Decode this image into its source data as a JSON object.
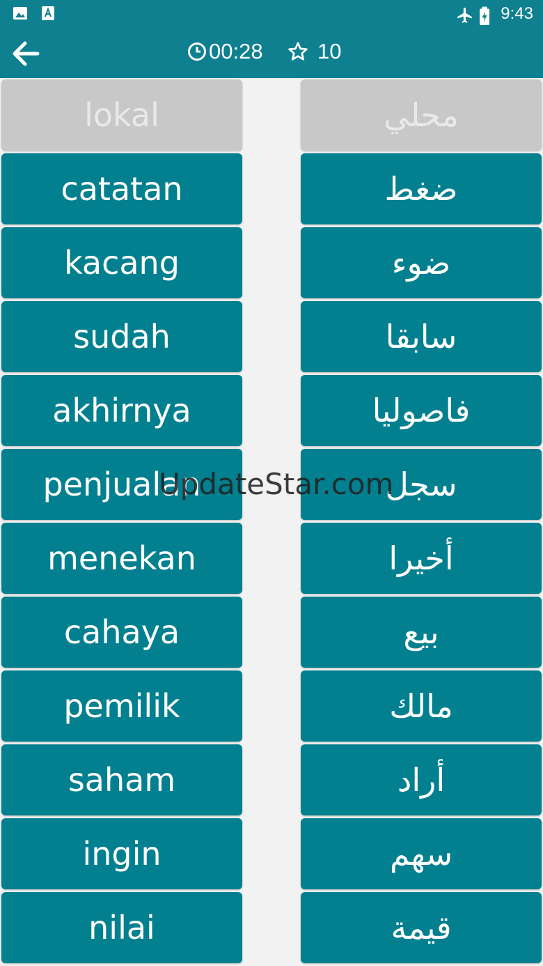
{
  "status_bar": {
    "time": "9:43",
    "icons_left": [
      "image-icon",
      "text-a-icon"
    ],
    "icons_right": [
      "airplane-icon",
      "battery-charging-icon"
    ]
  },
  "app_bar": {
    "timer": "00:28",
    "score": "10",
    "back_icon": "arrow-left-icon",
    "timer_icon": "clock-icon",
    "score_icon": "star-outline-icon"
  },
  "colors": {
    "primary": "#0e8090",
    "tile": "#03808f",
    "tile_done": "#c8c8c8",
    "background": "#f2f2f2"
  },
  "left_words": [
    {
      "text": "lokal",
      "matched": true
    },
    {
      "text": "catatan",
      "matched": false
    },
    {
      "text": "kacang",
      "matched": false
    },
    {
      "text": "sudah",
      "matched": false
    },
    {
      "text": "akhirnya",
      "matched": false
    },
    {
      "text": "penjualan",
      "matched": false
    },
    {
      "text": "menekan",
      "matched": false
    },
    {
      "text": "cahaya",
      "matched": false
    },
    {
      "text": "pemilik",
      "matched": false
    },
    {
      "text": "saham",
      "matched": false
    },
    {
      "text": "ingin",
      "matched": false
    },
    {
      "text": "nilai",
      "matched": false
    }
  ],
  "right_words": [
    {
      "text": "محلي",
      "matched": true
    },
    {
      "text": "ضغط",
      "matched": false
    },
    {
      "text": "ضوء",
      "matched": false
    },
    {
      "text": "سابقا",
      "matched": false
    },
    {
      "text": "فاصوليا",
      "matched": false
    },
    {
      "text": "سجل",
      "matched": false
    },
    {
      "text": "أخيرا",
      "matched": false
    },
    {
      "text": "بيع",
      "matched": false
    },
    {
      "text": "مالك",
      "matched": false
    },
    {
      "text": "أراد",
      "matched": false
    },
    {
      "text": "سهم",
      "matched": false
    },
    {
      "text": "قيمة",
      "matched": false
    }
  ],
  "watermark": "UpdateStar.com"
}
